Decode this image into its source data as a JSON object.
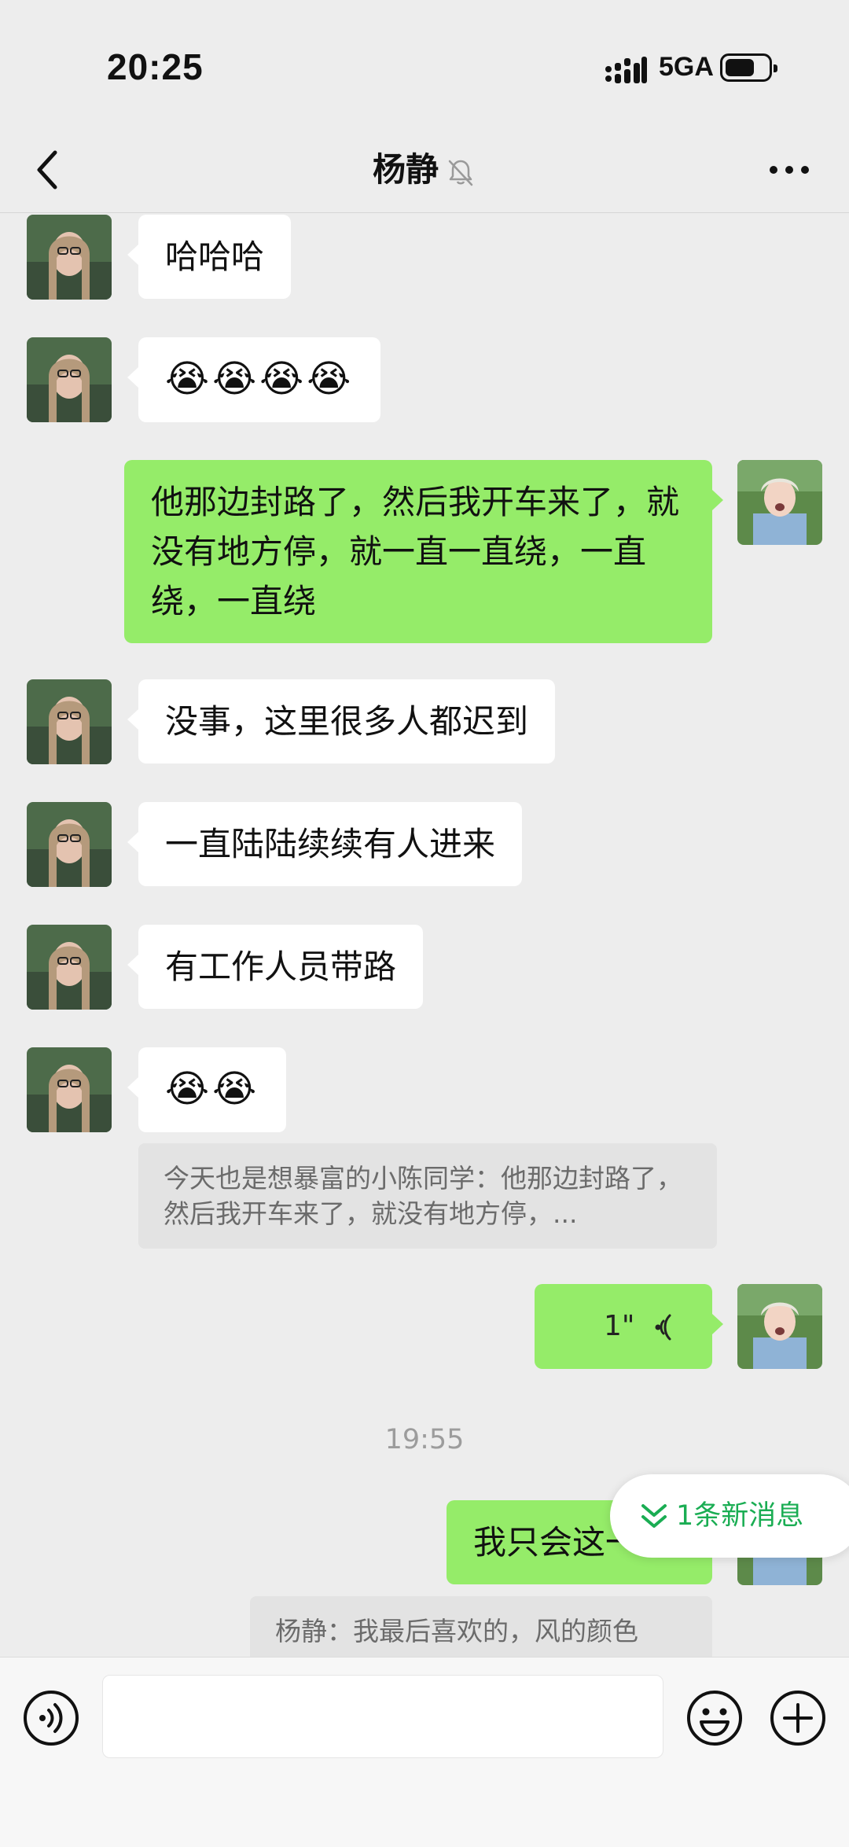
{
  "status_bar": {
    "time": "20:25",
    "network": "5GA"
  },
  "header": {
    "contact_name": "杨静"
  },
  "messages": {
    "m1": "哈哈哈",
    "m2": "😭😭😭😭",
    "m3": "他那边封路了，然后我开车来了，就没有地方停，就一直一直绕，一直绕，一直绕",
    "m4": "没事，这里很多人都迟到",
    "m5": "一直陆陆续续有人进来",
    "m6": "有工作人员带路",
    "m7": "😭😭",
    "m7_quote": "今天也是想暴富的小陈同学：他那边封路了，然后我开车来了，就没有地方停，...",
    "m8_voice_duration": "1\"",
    "timestamp": "19:55",
    "m9": "我只会这一首",
    "m9_quote": "杨静：我最后喜欢的，风的颜色"
  },
  "new_message_pill": {
    "label": "1条新消息"
  },
  "colors": {
    "outgoing_bubble": "#95ec69",
    "incoming_bubble": "#ffffff",
    "accent": "#1aad53",
    "background": "#ededed"
  },
  "icons": [
    "back-icon",
    "mute-bell-icon",
    "more-icon",
    "voice-icon",
    "emoji-icon",
    "plus-icon",
    "double-chevron-down-icon"
  ]
}
